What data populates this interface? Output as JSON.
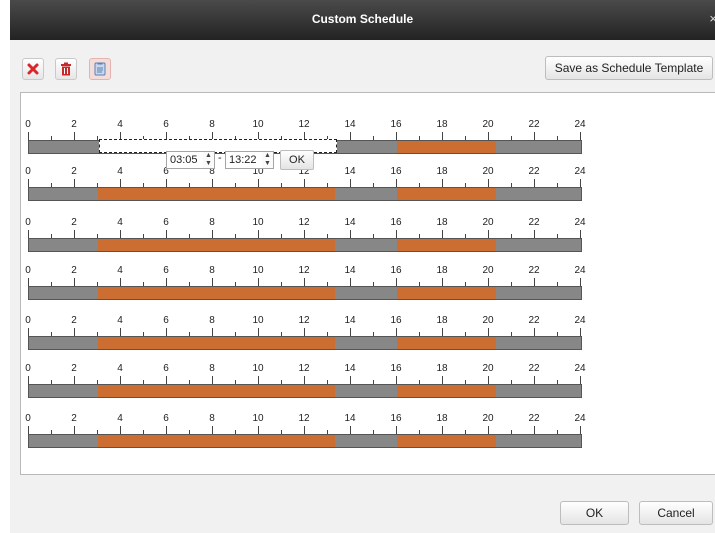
{
  "window": {
    "title": "Custom Schedule",
    "close_glyph": "×"
  },
  "toolbar": {
    "icons": [
      "delete-x-icon",
      "trash-icon",
      "copy-icon"
    ],
    "save_template_label": "Save as Schedule Template"
  },
  "ticks": [
    "0",
    "2",
    "4",
    "6",
    "8",
    "10",
    "12",
    "14",
    "16",
    "18",
    "20",
    "22",
    "24"
  ],
  "schedule": {
    "segment_color": "#cc6e31",
    "bar_color": "#878787",
    "rows": [
      {
        "segments": [
          [
            16,
            20.3
          ]
        ],
        "selected": [
          3.083,
          13.367
        ]
      },
      {
        "segments": [
          [
            3,
            13.3
          ],
          [
            16,
            20.3
          ]
        ]
      },
      {
        "segments": [
          [
            3,
            13.3
          ],
          [
            16,
            20.3
          ]
        ]
      },
      {
        "segments": [
          [
            3,
            13.3
          ],
          [
            16,
            20.3
          ]
        ]
      },
      {
        "segments": [
          [
            3,
            13.3
          ],
          [
            16,
            20.3
          ]
        ]
      },
      {
        "segments": [
          [
            3,
            13.3
          ],
          [
            16,
            20.3
          ]
        ]
      },
      {
        "segments": [
          [
            3,
            13.3
          ],
          [
            16,
            20.3
          ]
        ]
      }
    ]
  },
  "time_editor": {
    "start": "03:05",
    "end": "13:22",
    "separator": "-",
    "ok_label": "OK"
  },
  "footer": {
    "ok_label": "OK",
    "cancel_label": "Cancel"
  }
}
